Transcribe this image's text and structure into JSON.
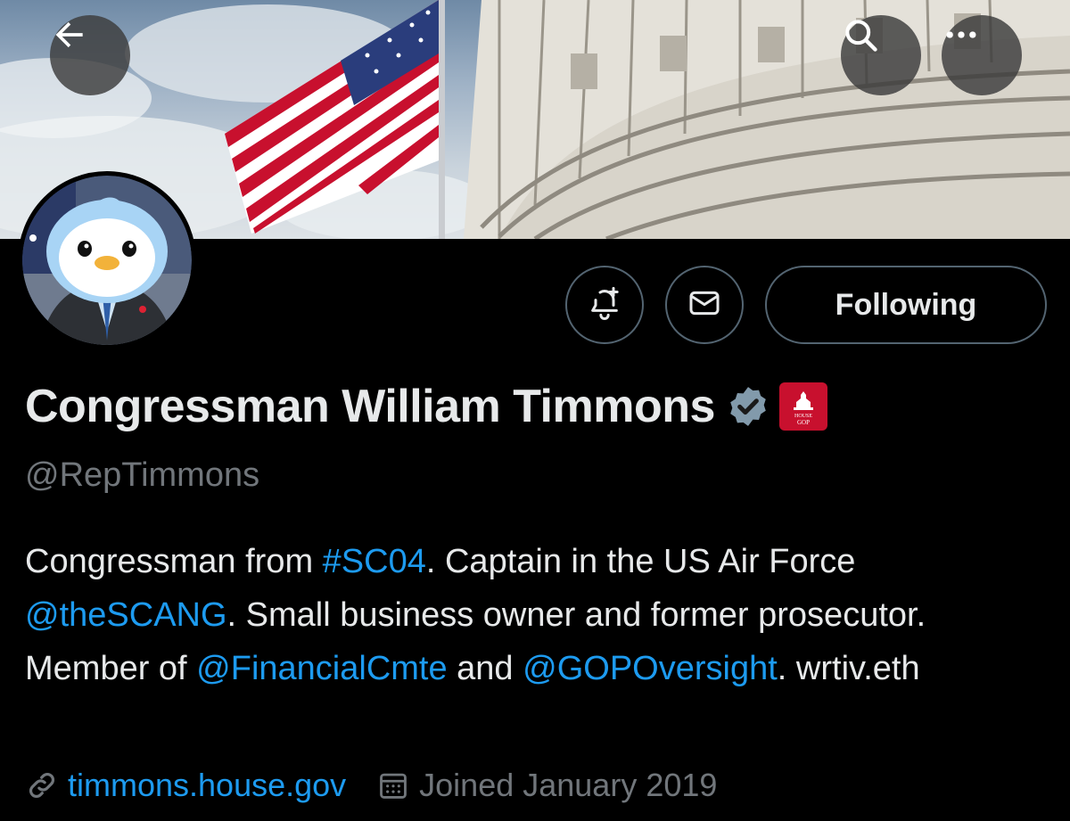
{
  "header": {
    "back_icon": "arrow-left-icon",
    "search_icon": "search-icon",
    "more_icon": "more-horizontal-icon"
  },
  "actions": {
    "notify_icon": "bell-plus-icon",
    "message_icon": "envelope-icon",
    "following_label": "Following"
  },
  "profile": {
    "name": "Congressman William Timmons",
    "verified_icon": "verified-badge-icon",
    "affiliate_badge": "house-gop-badge",
    "affiliate_badge_text_top": "HOUSE",
    "affiliate_badge_text_bottom": "GOP",
    "handle": "@RepTimmons"
  },
  "bio": {
    "t1": "Congressman from ",
    "hashtag": "#SC04",
    "t2": ". Captain in the US Air Force ",
    "mention1": "@theSCANG",
    "t3": ". Small business owner and former prosecutor. Member of ",
    "mention2": "@FinancialCmte",
    "t4": " and ",
    "mention3": "@GOPOversight",
    "t5": ". wrtiv.eth"
  },
  "meta": {
    "website_icon": "link-icon",
    "website": "timmons.house.gov",
    "joined_icon": "calendar-icon",
    "joined": "Joined January 2019"
  },
  "colors": {
    "background": "#000000",
    "text": "#e7e9ea",
    "muted": "#71767b",
    "link": "#1d9bf0",
    "verified": "#829aab",
    "affiliate_red": "#c8102e"
  }
}
